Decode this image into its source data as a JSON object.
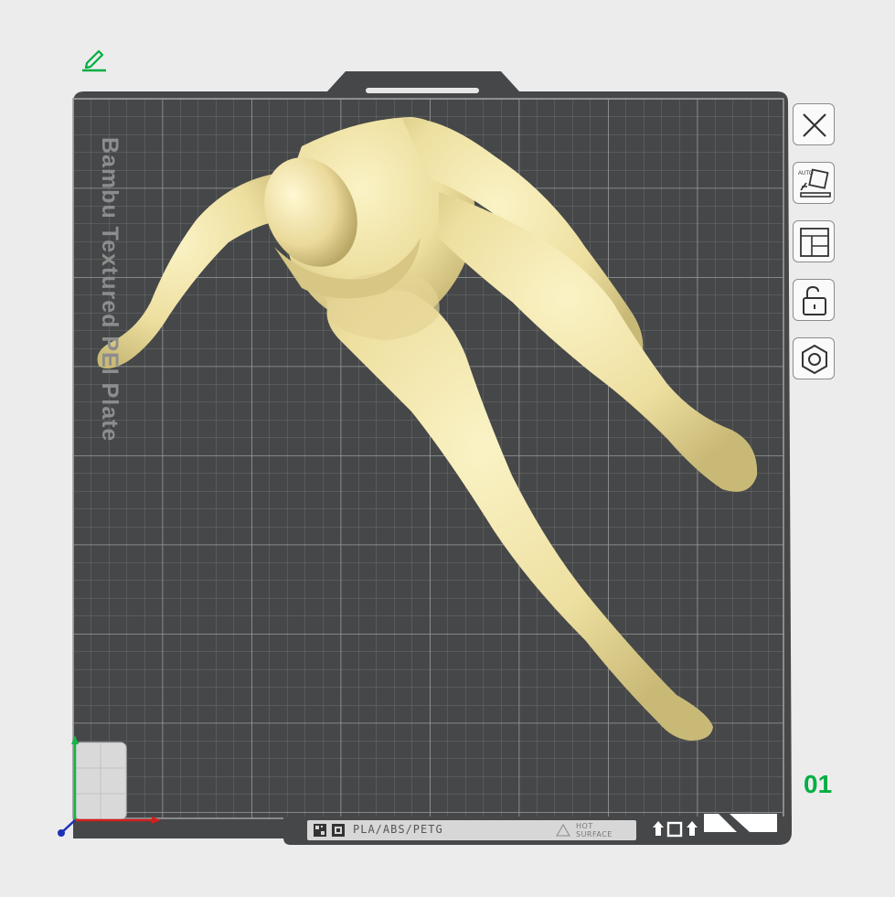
{
  "plate": {
    "label": "Bambu Textured PEI Plate",
    "number": "01",
    "filament_types": "PLA/ABS/PETG",
    "hot_surface_line1": "HOT",
    "hot_surface_line2": "SURFACE"
  },
  "toolbar": {
    "items": [
      {
        "name": "close",
        "icon": "close-icon"
      },
      {
        "name": "auto-orient",
        "icon": "auto-orient-icon",
        "text": "AUTO"
      },
      {
        "name": "arrange",
        "icon": "arrange-icon"
      },
      {
        "name": "lock",
        "icon": "unlock-icon"
      },
      {
        "name": "plate-settings",
        "icon": "hexagon-nut-icon"
      }
    ]
  },
  "colors": {
    "accent": "#00ae42",
    "plate": "#454748",
    "grid": "#7d7f80",
    "model": "#efe3a9",
    "background": "#ececec"
  }
}
